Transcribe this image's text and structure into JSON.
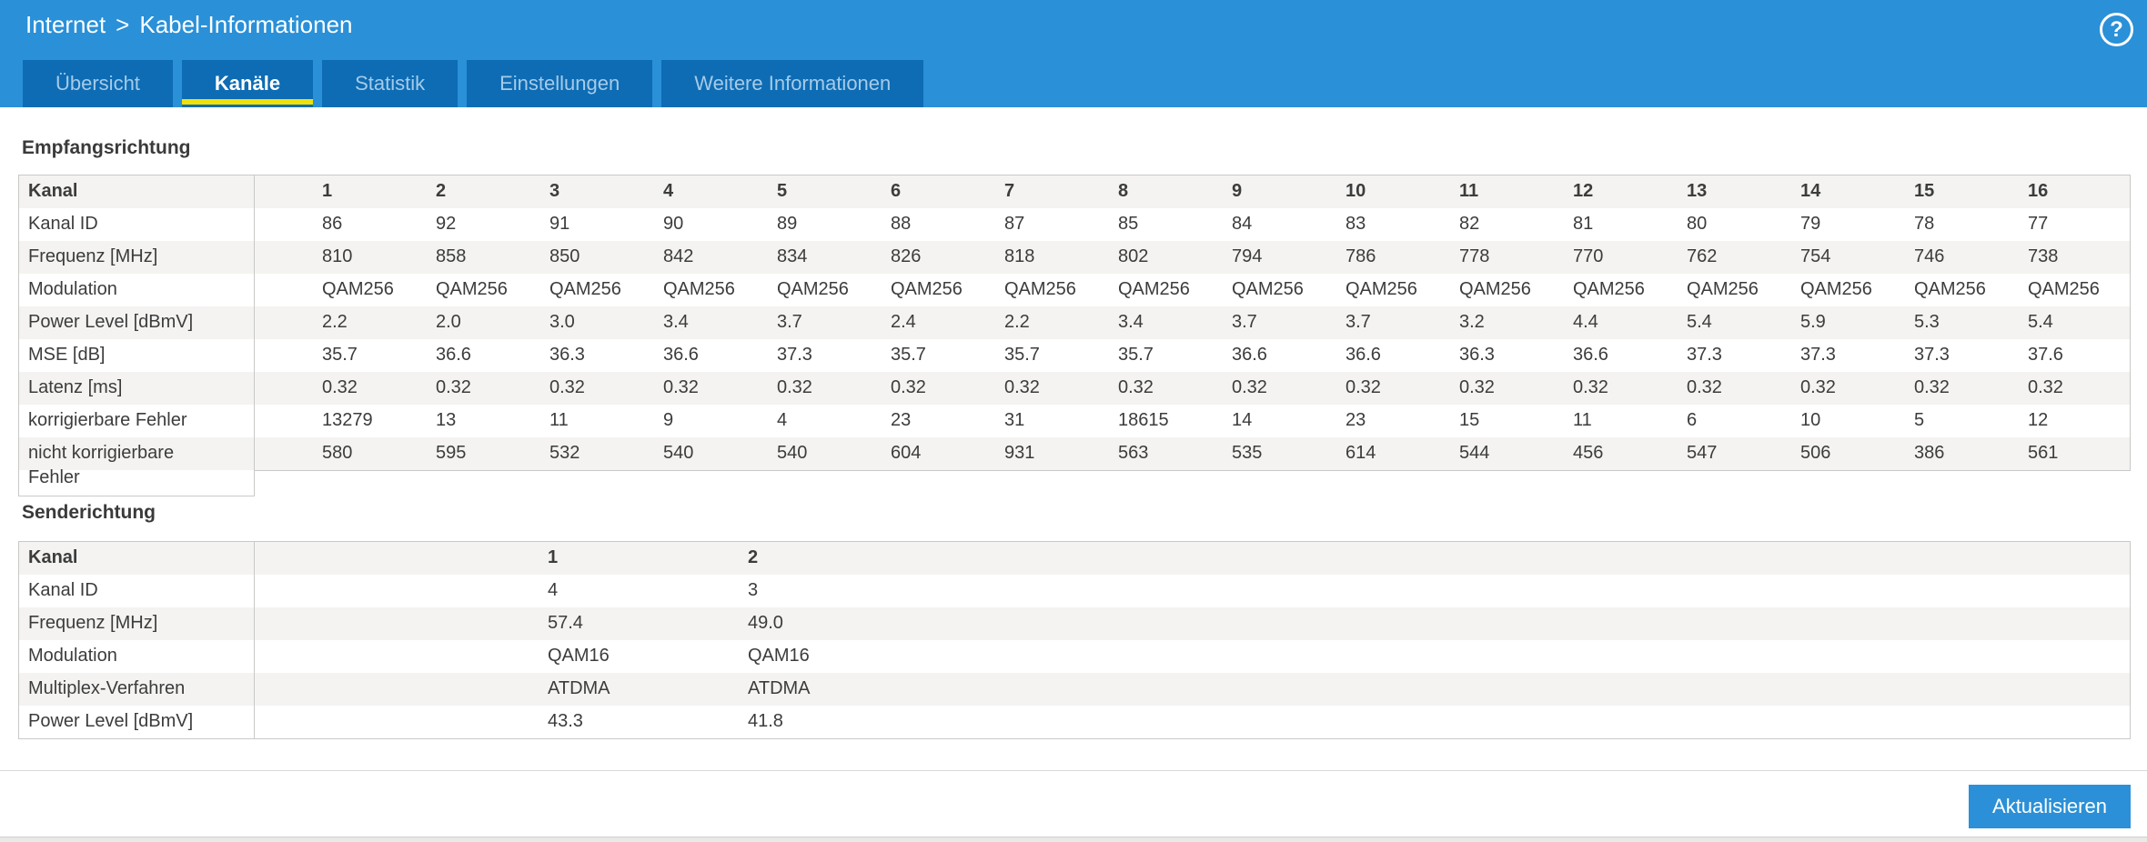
{
  "colors": {
    "header_blue": "#2a90d8",
    "tab_blue": "#0d6cb4",
    "tab_inactive_text": "#a5cbe9",
    "active_underline": "#f0e10a",
    "stripe": "#f4f3f1",
    "table_border": "#c9c9c7",
    "text_dark": "#3c3c3c",
    "button_blue": "#2b90d7",
    "footer_line": "#d9d9d9",
    "bottom_strip": "#e9e9e7"
  },
  "header": {
    "breadcrumb": {
      "items": [
        "Internet",
        "Kabel-Informationen"
      ],
      "separator": ">"
    },
    "help_icon": "?",
    "tabs": [
      {
        "label": "Übersicht",
        "active": false
      },
      {
        "label": "Kanäle",
        "active": true
      },
      {
        "label": "Statistik",
        "active": false
      },
      {
        "label": "Einstellungen",
        "active": false
      },
      {
        "label": "Weitere Informationen",
        "active": false
      }
    ]
  },
  "tables": {
    "receive": {
      "title": "Empfangsrichtung",
      "rows": [
        {
          "label": "Kanal",
          "header": true,
          "values": [
            "1",
            "2",
            "3",
            "4",
            "5",
            "6",
            "7",
            "8",
            "9",
            "10",
            "11",
            "12",
            "13",
            "14",
            "15",
            "16"
          ]
        },
        {
          "label": "Kanal ID",
          "values": [
            "86",
            "92",
            "91",
            "90",
            "89",
            "88",
            "87",
            "85",
            "84",
            "83",
            "82",
            "81",
            "80",
            "79",
            "78",
            "77"
          ]
        },
        {
          "label": "Frequenz [MHz]",
          "values": [
            "810",
            "858",
            "850",
            "842",
            "834",
            "826",
            "818",
            "802",
            "794",
            "786",
            "778",
            "770",
            "762",
            "754",
            "746",
            "738"
          ]
        },
        {
          "label": "Modulation",
          "values": [
            "QAM256",
            "QAM256",
            "QAM256",
            "QAM256",
            "QAM256",
            "QAM256",
            "QAM256",
            "QAM256",
            "QAM256",
            "QAM256",
            "QAM256",
            "QAM256",
            "QAM256",
            "QAM256",
            "QAM256",
            "QAM256"
          ]
        },
        {
          "label": "Power Level [dBmV]",
          "values": [
            "2.2",
            "2.0",
            "3.0",
            "3.4",
            "3.7",
            "2.4",
            "2.2",
            "3.4",
            "3.7",
            "3.7",
            "3.2",
            "4.4",
            "5.4",
            "5.9",
            "5.3",
            "5.4"
          ]
        },
        {
          "label": "MSE [dB]",
          "values": [
            "35.7",
            "36.6",
            "36.3",
            "36.6",
            "37.3",
            "35.7",
            "35.7",
            "35.7",
            "36.6",
            "36.6",
            "36.3",
            "36.6",
            "37.3",
            "37.3",
            "37.3",
            "37.6"
          ]
        },
        {
          "label": "Latenz [ms]",
          "values": [
            "0.32",
            "0.32",
            "0.32",
            "0.32",
            "0.32",
            "0.32",
            "0.32",
            "0.32",
            "0.32",
            "0.32",
            "0.32",
            "0.32",
            "0.32",
            "0.32",
            "0.32",
            "0.32"
          ]
        },
        {
          "label": "korrigierbare Fehler",
          "values": [
            "13279",
            "13",
            "11",
            "9",
            "4",
            "23",
            "31",
            "18615",
            "14",
            "23",
            "15",
            "11",
            "6",
            "10",
            "5",
            "12"
          ]
        },
        {
          "label": "nicht korrigierbare Fehler",
          "values": [
            "580",
            "595",
            "532",
            "540",
            "540",
            "604",
            "931",
            "563",
            "535",
            "614",
            "544",
            "456",
            "547",
            "506",
            "386",
            "561"
          ]
        }
      ]
    },
    "send": {
      "title": "Senderichtung",
      "rows": [
        {
          "label": "Kanal",
          "header": true,
          "values": [
            "1",
            "2"
          ]
        },
        {
          "label": "Kanal ID",
          "values": [
            "4",
            "3"
          ]
        },
        {
          "label": "Frequenz [MHz]",
          "values": [
            "57.4",
            "49.0"
          ]
        },
        {
          "label": "Modulation",
          "values": [
            "QAM16",
            "QAM16"
          ]
        },
        {
          "label": "Multiplex-Verfahren",
          "values": [
            "ATDMA",
            "ATDMA"
          ]
        },
        {
          "label": "Power Level [dBmV]",
          "values": [
            "43.3",
            "41.8"
          ]
        }
      ]
    }
  },
  "footer": {
    "refresh_button": "Aktualisieren"
  }
}
